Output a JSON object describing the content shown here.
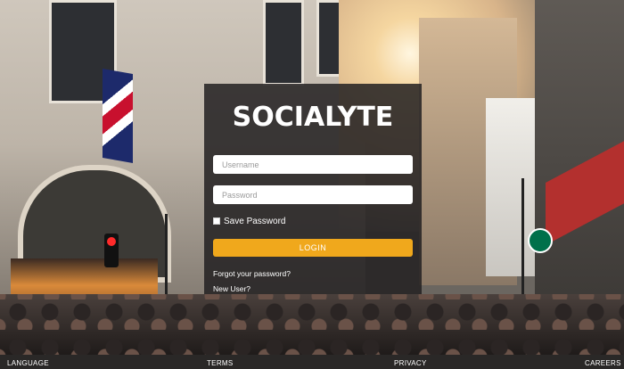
{
  "brand": {
    "logo_text": "SOCIALYTE"
  },
  "login": {
    "username_placeholder": "Username",
    "password_placeholder": "Password",
    "save_password_label": "Save Password",
    "save_password_checked": false,
    "login_button_label": "LOGIN",
    "forgot_password_link": "Forgot your password?",
    "new_user_link": "New User?"
  },
  "footer": {
    "language": "LANGUAGE",
    "terms": "TERMS",
    "privacy": "PRIVACY",
    "careers": "CAREERS"
  },
  "colors": {
    "accent": "#f0a81c",
    "panel": "#232122",
    "footer": "#2a2827",
    "text": "#ffffff"
  }
}
